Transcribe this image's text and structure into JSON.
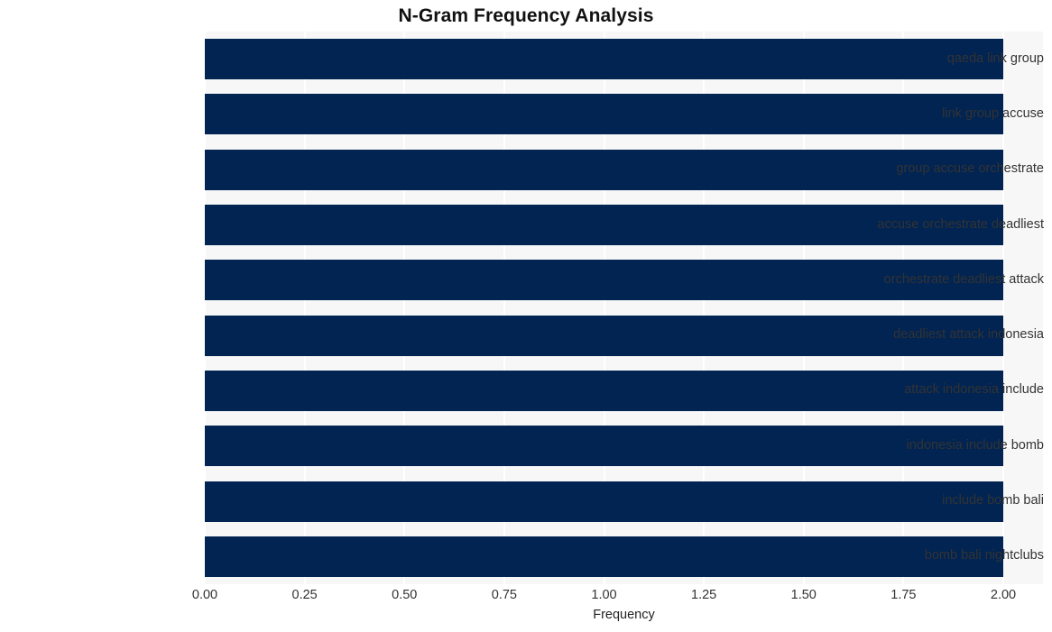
{
  "chart_data": {
    "type": "bar",
    "orientation": "horizontal",
    "title": "N-Gram Frequency Analysis",
    "xlabel": "Frequency",
    "ylabel": "",
    "categories": [
      "qaeda link group",
      "link group accuse",
      "group accuse orchestrate",
      "accuse orchestrate deadliest",
      "orchestrate deadliest attack",
      "deadliest attack indonesia",
      "attack indonesia include",
      "indonesia include bomb",
      "include bomb bali",
      "bomb bali nightclubs"
    ],
    "values": [
      2,
      2,
      2,
      2,
      2,
      2,
      2,
      2,
      2,
      2
    ],
    "xlim": [
      0,
      2
    ],
    "xticks": [
      "0.00",
      "0.25",
      "0.50",
      "0.75",
      "1.00",
      "1.25",
      "1.50",
      "1.75",
      "2.00"
    ],
    "xtick_values": [
      0,
      0.25,
      0.5,
      0.75,
      1,
      1.25,
      1.5,
      1.75,
      2
    ],
    "grid": true,
    "legend": false,
    "bar_color": "#012452",
    "plot_background": "#f7f7f7",
    "grid_color": "#ffffff",
    "text_color": "#333333"
  }
}
